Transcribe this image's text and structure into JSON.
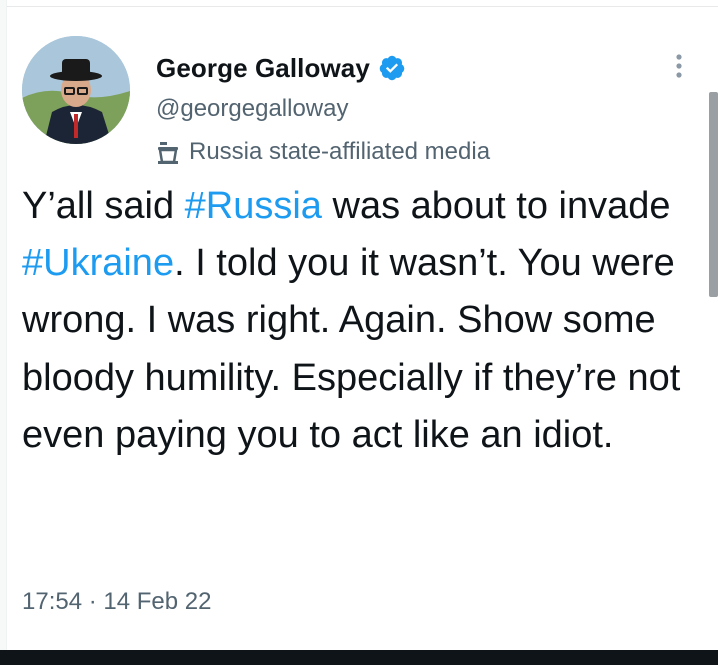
{
  "tweet": {
    "author": {
      "display_name": "George Galloway",
      "handle": "@georgegalloway",
      "verified": true,
      "avatar_icon": "profile-photo"
    },
    "label": {
      "icon": "podium-icon",
      "text": "Russia state-affiliated media"
    },
    "text": {
      "part1": "Y’all said ",
      "hashtag1": "#Russia",
      "part2": " was about to invade ",
      "hashtag2": "#Ukraine",
      "part3": ". I told you it wasn’t. You were wrong. I was right. Again. Show some bloody humility. Especially if they’re not even paying you to act like an idiot."
    },
    "time": "17:54",
    "separator": "·",
    "date": "14 Feb 22"
  },
  "colors": {
    "hashtag": "#1d9bf0",
    "verified_badge": "#1d9bf0",
    "secondary_text": "#536471",
    "primary_text": "#0f1419"
  }
}
